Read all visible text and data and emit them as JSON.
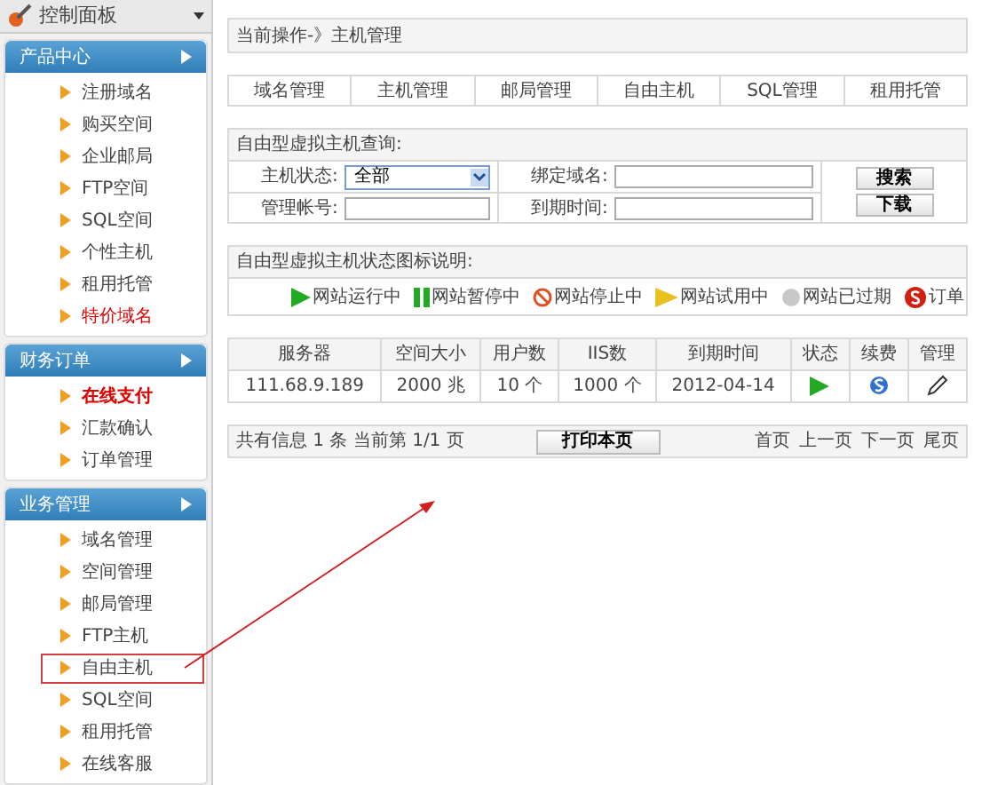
{
  "sidebar": {
    "title": "控制面板",
    "sections": [
      {
        "title": "产品中心",
        "items": [
          {
            "label": "注册域名",
            "kind": "normal",
            "annotated": false
          },
          {
            "label": "购买空间",
            "kind": "normal",
            "annotated": false
          },
          {
            "label": "企业邮局",
            "kind": "normal",
            "annotated": false
          },
          {
            "label": "FTP空间",
            "kind": "normal",
            "annotated": false
          },
          {
            "label": "SQL空间",
            "kind": "normal",
            "annotated": false
          },
          {
            "label": "个性主机",
            "kind": "normal",
            "annotated": false
          },
          {
            "label": "租用托管",
            "kind": "normal",
            "annotated": false
          },
          {
            "label": "特价域名",
            "kind": "red",
            "annotated": false
          }
        ]
      },
      {
        "title": "财务订单",
        "items": [
          {
            "label": "在线支付",
            "kind": "bold-red",
            "annotated": false
          },
          {
            "label": "汇款确认",
            "kind": "normal",
            "annotated": false
          },
          {
            "label": "订单管理",
            "kind": "normal",
            "annotated": false
          }
        ]
      },
      {
        "title": "业务管理",
        "items": [
          {
            "label": "域名管理",
            "kind": "normal",
            "annotated": false
          },
          {
            "label": "空间管理",
            "kind": "normal",
            "annotated": false
          },
          {
            "label": "邮局管理",
            "kind": "normal",
            "annotated": false
          },
          {
            "label": "FTP主机",
            "kind": "normal",
            "annotated": false
          },
          {
            "label": "自由主机",
            "kind": "normal",
            "annotated": true
          },
          {
            "label": "SQL空间",
            "kind": "normal",
            "annotated": false
          },
          {
            "label": "租用托管",
            "kind": "normal",
            "annotated": false
          },
          {
            "label": "在线客服",
            "kind": "normal",
            "annotated": false
          }
        ]
      }
    ]
  },
  "breadcrumb": "当前操作-》主机管理",
  "tabs": [
    "域名管理",
    "主机管理",
    "邮局管理",
    "自由主机",
    "SQL管理",
    "租用托管"
  ],
  "search": {
    "title": "自由型虚拟主机查询:",
    "status_label": "主机状态:",
    "status_value": "全部",
    "domain_label": "绑定域名:",
    "account_label": "管理帐号:",
    "expire_label": "到期时间:",
    "buttons": [
      "搜索",
      "下载"
    ]
  },
  "legend": {
    "title": "自由型虚拟主机状态图标说明:",
    "items": [
      {
        "kind": "running",
        "label": "网站运行中"
      },
      {
        "kind": "paused",
        "label": "网站暂停中"
      },
      {
        "kind": "stopped",
        "label": "网站停止中"
      },
      {
        "kind": "trial",
        "label": "网站试用中"
      },
      {
        "kind": "expired",
        "label": "网站已过期"
      },
      {
        "kind": "order",
        "label": "订单"
      }
    ]
  },
  "table": {
    "columns": [
      "服务器",
      "空间大小",
      "用户数",
      "IIS数",
      "到期时间",
      "状态",
      "续费",
      "管理"
    ],
    "rows": [
      {
        "server": "111.68.9.189",
        "space": "2000 兆",
        "users": "10 个",
        "iis": "1000 个",
        "expires": "2012-04-14"
      }
    ]
  },
  "pagination": {
    "info": "共有信息 1 条 当前第 1/1 页",
    "print": "打印本页",
    "links": [
      "首页",
      "上一页",
      "下一页",
      "尾页"
    ]
  }
}
